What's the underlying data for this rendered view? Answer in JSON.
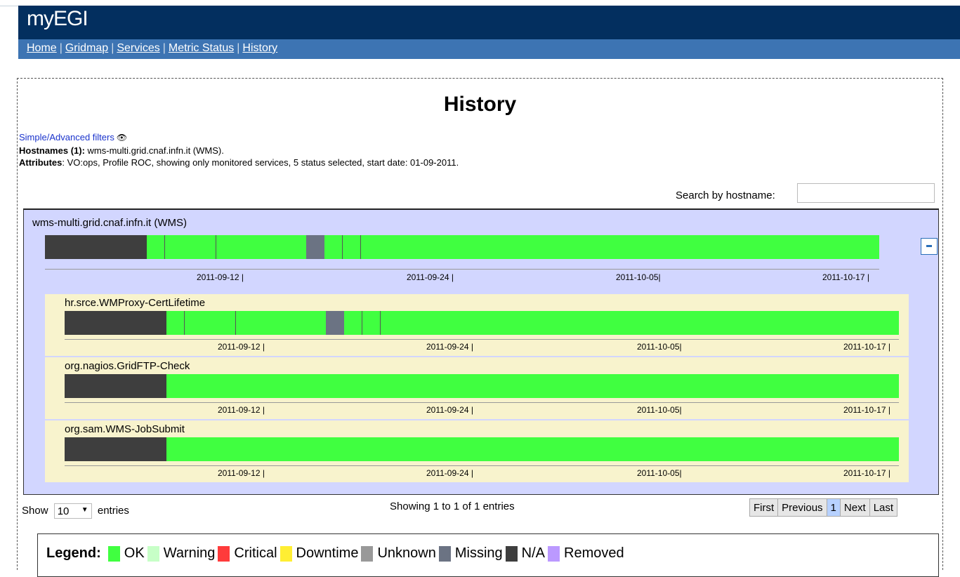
{
  "header": {
    "logo": "myEGI",
    "nav": [
      "Home",
      "Gridmap",
      "Services",
      "Metric Status",
      "History"
    ]
  },
  "page": {
    "title": "History",
    "filters_link": "Simple/Advanced filters",
    "hostnames_label": "Hostnames (1):",
    "hostnames_value": " wms-multi.grid.cnaf.infn.it (WMS).",
    "attributes_label": "Attributes",
    "attributes_value": ": VO:ops, Profile ROC, showing only monitored services, 5 status selected, start date: 01-09-2011.",
    "search_label": "Search by hostname:",
    "search_value": ""
  },
  "service": {
    "name": "wms-multi.grid.cnaf.infn.it (WMS)",
    "axis_labels": [
      "2011-09-12 |",
      "2011-09-24 |",
      "2011-10-05|",
      "2011-10-17 |"
    ],
    "metrics": [
      {
        "name": "hr.srce.WMProxy-CertLifetime",
        "axis_labels": [
          "2011-09-12 |",
          "2011-09-24 |",
          "2011-10-05|",
          "2011-10-17 |"
        ]
      },
      {
        "name": "org.nagios.GridFTP-Check",
        "axis_labels": [
          "2011-09-12 |",
          "2011-09-24 |",
          "2011-10-05|",
          "2011-10-17 |"
        ]
      },
      {
        "name": "org.sam.WMS-JobSubmit",
        "axis_labels": [
          "2011-09-12 |",
          "2011-09-24 |",
          "2011-10-05|",
          "2011-10-17 |"
        ]
      }
    ]
  },
  "table": {
    "show_label": "Show",
    "entries_value": "10",
    "entries_label": "entries",
    "info": "Showing 1 to 1 of 1 entries",
    "pager": [
      "First",
      "Previous",
      "1",
      "Next",
      "Last"
    ]
  },
  "legend": {
    "title": "Legend:",
    "items": [
      {
        "label": "OK",
        "color": "#40ff40"
      },
      {
        "label": "Warning",
        "color": "#c7ffc7"
      },
      {
        "label": "Critical",
        "color": "#ff3b3b"
      },
      {
        "label": "Downtime",
        "color": "#ffee33"
      },
      {
        "label": "Unknown",
        "color": "#999999"
      },
      {
        "label": "Missing",
        "color": "#6b7383"
      },
      {
        "label": "N/A",
        "color": "#3e3e3e"
      },
      {
        "label": "Removed",
        "color": "#bb99ff"
      }
    ]
  },
  "colors": {
    "ok": "#40ff40",
    "na": "#3e3e3e",
    "missing": "#6b7383",
    "banner": "#032f5f",
    "navbar": "#3d74b3",
    "panel": "#d2d6ff",
    "metric_bg": "#f8f3cd"
  }
}
